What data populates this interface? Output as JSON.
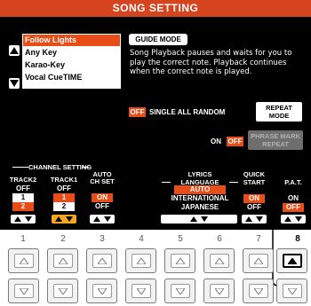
{
  "title": "SONG SETTING",
  "modes": [
    "Follow Lights",
    "Any Key",
    "Karao-Key",
    "Vocal CueTIME"
  ],
  "guide": {
    "button": "GUIDE MODE",
    "description": "Song Playback pauses and waits for you to play the correct note. Playback continues when the correct note is played."
  },
  "repeat": {
    "off": "OFF",
    "options": "SINGLE ALL RANDOM",
    "button_line1": "REPEAT",
    "button_line2": "MODE"
  },
  "phrase": {
    "on": "ON",
    "off": "OFF",
    "button_line1": "PHRASE MARK",
    "button_line2": "REPEAT"
  },
  "channel_setting": {
    "label": "CHANNEL SETTING",
    "track2": {
      "header": "TRACK2",
      "values": [
        "OFF",
        "1",
        "2"
      ]
    },
    "track1": {
      "header": "TRACK1",
      "values": [
        "OFF",
        "1",
        "2"
      ]
    },
    "auto_ch": {
      "header1": "AUTO",
      "header2": "CH SET",
      "values": [
        "ON",
        "OFF"
      ]
    }
  },
  "lyrics": {
    "header1": "LYRICS",
    "header2": "LANGUAGE",
    "values": [
      "AUTO",
      "INTERNATIONAL",
      "JAPANESE"
    ]
  },
  "quick_start": {
    "header1": "QUICK",
    "header2": "START",
    "values": [
      "ON",
      "OFF"
    ]
  },
  "pat": {
    "header": "P.A.T.",
    "values": [
      "ON",
      "OFF"
    ]
  },
  "columns": [
    "1",
    "2",
    "3",
    "4",
    "5",
    "6",
    "7",
    "8"
  ],
  "colors": {
    "accent": "#e84c17",
    "title": "#d6431f",
    "active_nav": "#f5a623"
  }
}
